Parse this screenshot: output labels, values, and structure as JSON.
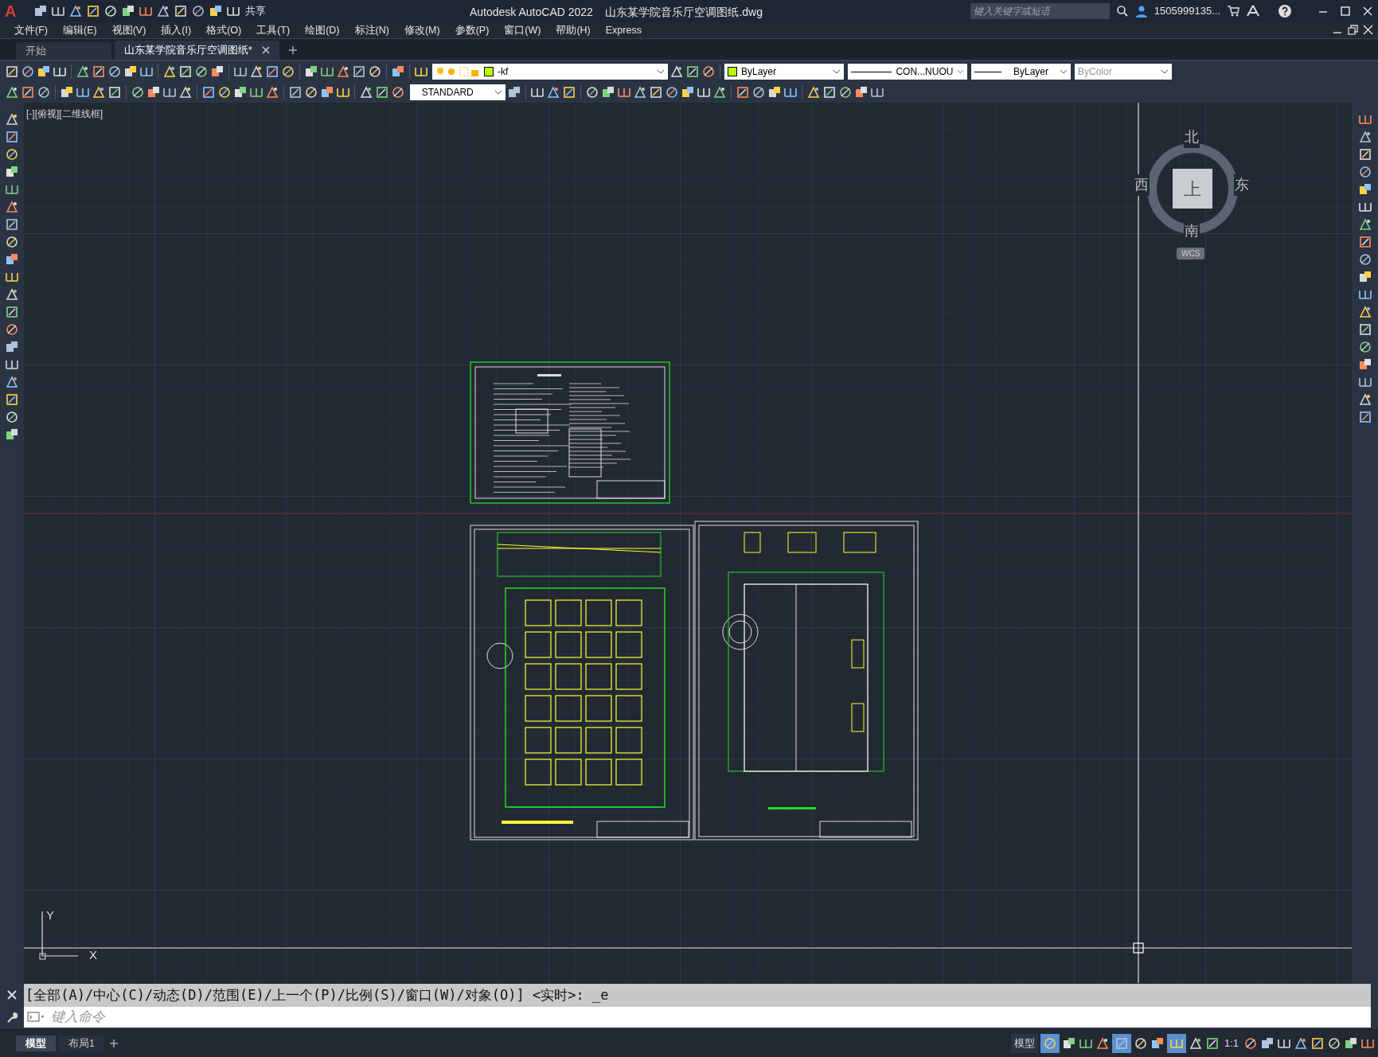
{
  "title_bar": {
    "app_menu": "A",
    "share": "共享",
    "title": "Autodesk AutoCAD 2022    山东某学院音乐厅空调图纸.dwg",
    "search": {
      "placeholder": "键入关键字或短语"
    },
    "user": "1505999135..."
  },
  "menu": [
    "文件(F)",
    "编辑(E)",
    "视图(V)",
    "插入(I)",
    "格式(O)",
    "工具(T)",
    "绘图(D)",
    "标注(N)",
    "修改(M)",
    "参数(P)",
    "窗口(W)",
    "帮助(H)",
    "Express"
  ],
  "tabs": [
    {
      "label": "开始",
      "selected": false
    },
    {
      "label": "山东某学院音乐厅空调图纸*",
      "selected": true
    }
  ],
  "toolbar": {
    "layer": {
      "value": "-kf",
      "color": "#bfff00"
    },
    "text_style": "STANDARD",
    "color": {
      "value": "ByLayer",
      "color": "#bfff00"
    },
    "linetype": "CON...NUOU",
    "lineweight": "ByLayer",
    "plot_style": {
      "value": "ByColor",
      "disabled": true
    }
  },
  "viewport": {
    "label": "[-][俯视][二维线框]",
    "viewcube": {
      "north": "北",
      "south": "南",
      "east": "东",
      "west": "西",
      "face": "上",
      "ucs": "WCS"
    },
    "axis_y": "Y",
    "axis_x": "X"
  },
  "command": {
    "history": "[全部(A)/中心(C)/动态(D)/范围(E)/上一个(P)/比例(S)/窗口(W)/对象(O)] <实时>: _e",
    "placeholder": "键入命令"
  },
  "layout_tabs": [
    {
      "label": "模型",
      "selected": true
    },
    {
      "label": "布局1",
      "selected": false
    }
  ],
  "status_bar": {
    "space": "模型",
    "scale": "1:1"
  }
}
